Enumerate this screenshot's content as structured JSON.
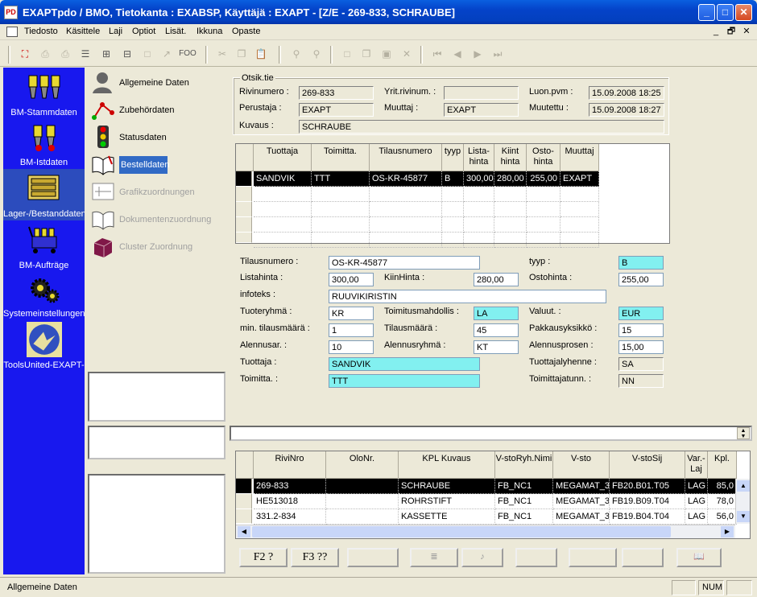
{
  "window": {
    "title": "EXAPTpdo / BMO, Tietokanta : EXABSP, Käyttäjä : EXAPT - [Z/E - 269-833, SCHRAUBE]",
    "min": "_",
    "max": "□",
    "close": "✕"
  },
  "menu": [
    "Tiedosto",
    "Käsittele",
    "Laji",
    "Optiot",
    "Lisät.",
    "Ikkuna",
    "Opaste"
  ],
  "mdi_controls": [
    "_",
    "🗗",
    "✕"
  ],
  "toolbar": {
    "foo_label": "FOO"
  },
  "left_nav": [
    {
      "label": "BM-Stammdaten",
      "icon": "stammdaten-icon"
    },
    {
      "label": "BM-Istdaten",
      "icon": "istdaten-icon"
    },
    {
      "label": "Lager-/Bestanddaten",
      "icon": "lager-icon"
    },
    {
      "label": "BM-Aufträge",
      "icon": "auftraege-icon"
    },
    {
      "label": "Systemeinstellungen",
      "icon": "settings-icon"
    },
    {
      "label": "ToolsUnited-EXAPT-",
      "icon": "toolsunited-icon"
    }
  ],
  "mid_nav": [
    {
      "label": "Allgemeine Daten",
      "icon": "person-icon"
    },
    {
      "label": "Zubehördaten",
      "icon": "accessory-icon"
    },
    {
      "label": "Statusdaten",
      "icon": "traffic-light-icon"
    },
    {
      "label": "Bestelldaten",
      "icon": "book-icon"
    },
    {
      "label": "Grafikzuordnungen",
      "icon": "graphic-icon"
    },
    {
      "label": "Dokumentenzuordnung",
      "icon": "document-icon"
    },
    {
      "label": "Cluster Zuordnung",
      "icon": "cube-icon"
    }
  ],
  "header": {
    "group_label": "Otsik.tie",
    "rivinumero_label": "Rivinumero :",
    "rivinumero": "269-833",
    "yrit_label": "Yrit.rivinum. :",
    "yrit": "",
    "luon_label": "Luon.pvm :",
    "luon": "15.09.2008 18:25",
    "perustaja_label": "Perustaja :",
    "perustaja": "EXAPT",
    "muuttaja_label": "Muuttaj :",
    "muuttaja": "EXAPT",
    "muutettu_label": "Muutettu :",
    "muutettu": "15.09.2008 18:27",
    "kuvaus_label": "Kuvaus :",
    "kuvaus": "SCHRAUBE"
  },
  "order_grid": {
    "columns": [
      "Tuottaja",
      "Toimitta.",
      "Tilausnumero",
      "tyyp",
      "Lista-\nhinta",
      "Kiint\nhinta",
      "Osto-\nhinta",
      "Muuttaj"
    ],
    "rows": [
      [
        "SANDVIK",
        "TTT",
        "OS-KR-45877",
        "B",
        "300,00",
        "280,00",
        "255,00",
        "EXAPT"
      ]
    ]
  },
  "detail": {
    "tilausnumero_label": "Tilausnumero :",
    "tilausnumero": "OS-KR-45877",
    "tyyp_label": "tyyp :",
    "tyyp": "B",
    "listahinta_label": "Listahinta :",
    "listahinta": "300,00",
    "kiinhinta_label": "KiinHinta :",
    "kiinhinta": "280,00",
    "ostohinta_label": "Ostohinta :",
    "ostohinta": "255,00",
    "infoteks_label": "infoteks :",
    "infoteks": "RUUVIKIRISTIN",
    "tuoteryhma_label": "Tuoteryhmä :",
    "tuoteryhma": "KR",
    "toimitusmahd_label": "Toimitusmahdollis :",
    "toimitusmahd": "LA",
    "valuut_label": "Valuut. :",
    "valuut": "EUR",
    "mintilaus_label": "min. tilausmäärä :",
    "mintilaus": "1",
    "tilausmaara_label": "Tilausmäärä :",
    "tilausmaara": "45",
    "pakkaus_label": "Pakkausyksikkö :",
    "pakkaus": "15",
    "alennusar_label": "Alennusar. :",
    "alennusar": "10",
    "alennusryhma_label": "Alennusryhmä :",
    "alennusryhma": "KT",
    "alennusprosen_label": "Alennusprosen :",
    "alennusprosen": "15,00",
    "tuottaja_label": "Tuottaja :",
    "tuottaja": "SANDVIK",
    "tuottajalyh_label": "Tuottajalyhenne :",
    "tuottajalyh": "SA",
    "toimitta_label": "Toimitta. :",
    "toimitta": "TTT",
    "toimittajatunn_label": "Toimittajatunn. :",
    "toimittajatunn": "NN"
  },
  "stock_grid": {
    "columns": [
      "RiviNro",
      "OloNr.",
      "KPL Kuvaus",
      "V-stoRyh.Nimi",
      "V-sto",
      "V-stoSij",
      "Var.-\nLaj",
      "Kpl."
    ],
    "rows": [
      [
        "269-833",
        "",
        "SCHRAUBE",
        "FB_NC1",
        "MEGAMAT_3",
        "FB20.B01.T05",
        "LAG",
        "85,0"
      ],
      [
        "HE513018",
        "",
        "ROHRSTIFT",
        "FB_NC1",
        "MEGAMAT_3",
        "FB19.B09.T04",
        "LAG",
        "78,0"
      ],
      [
        "331.2-834",
        "",
        "KASSETTE",
        "FB_NC1",
        "MEGAMAT_3",
        "FB19.B04.T04",
        "LAG",
        "56,0"
      ]
    ]
  },
  "fkeys": {
    "f2": "F2  ?",
    "f3": "F3 ??"
  },
  "status": {
    "text": "Allgemeine Daten",
    "num": "NUM"
  }
}
